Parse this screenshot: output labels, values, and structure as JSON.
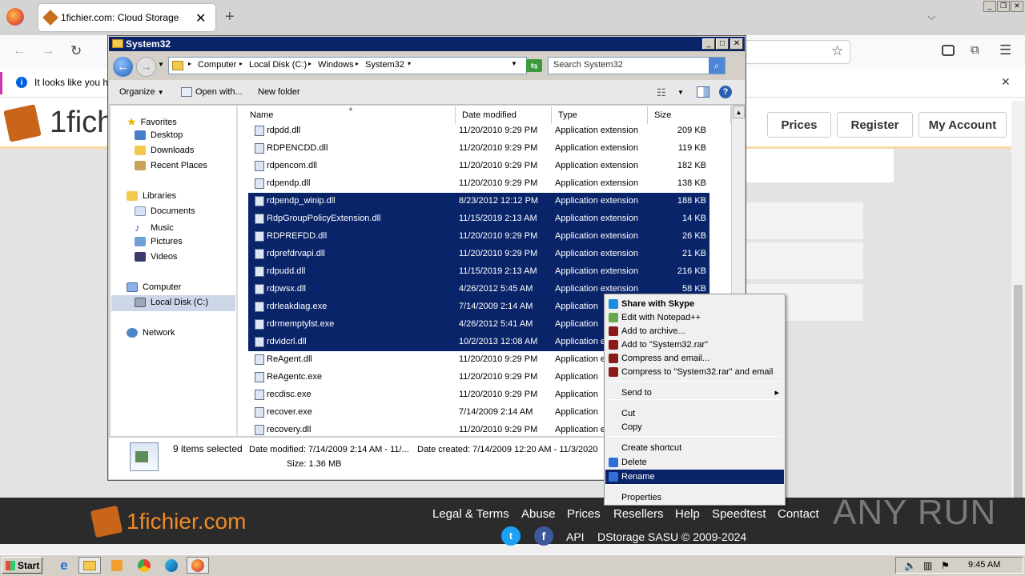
{
  "browser": {
    "tab_title": "1fichier.com: Cloud Storage",
    "notification": "It looks like you ha",
    "colors": {
      "accent": "#c837ab"
    }
  },
  "site": {
    "logo_text": "1fich",
    "nav": {
      "prices": "Prices",
      "register": "Register",
      "account": "My Account"
    },
    "footer": {
      "logo": "1fichier.com",
      "links": [
        "Legal & Terms",
        "Abuse",
        "Prices",
        "Resellers",
        "Help",
        "Speedtest",
        "Contact"
      ],
      "api": "API",
      "copyright": "DStorage SASU © 2009-2024"
    },
    "watermark": "ANY RUN"
  },
  "explorer": {
    "title": "System32",
    "breadcrumb": [
      "Computer",
      "Local Disk (C:)",
      "Windows",
      "System32"
    ],
    "search_placeholder": "Search System32",
    "toolbar": {
      "organize": "Organize",
      "open_with": "Open with...",
      "new_folder": "New folder"
    },
    "nav": {
      "favorites": "Favorites",
      "desktop": "Desktop",
      "downloads": "Downloads",
      "recent": "Recent Places",
      "libraries": "Libraries",
      "documents": "Documents",
      "music": "Music",
      "pictures": "Pictures",
      "videos": "Videos",
      "computer": "Computer",
      "local_disk": "Local Disk (C:)",
      "network": "Network"
    },
    "columns": {
      "name": "Name",
      "date": "Date modified",
      "type": "Type",
      "size": "Size"
    },
    "files": [
      {
        "name": "rdpdd.dll",
        "date": "11/20/2010 9:29 PM",
        "type": "Application extension",
        "size": "209 KB",
        "sel": false
      },
      {
        "name": "RDPENCDD.dll",
        "date": "11/20/2010 9:29 PM",
        "type": "Application extension",
        "size": "119 KB",
        "sel": false
      },
      {
        "name": "rdpencom.dll",
        "date": "11/20/2010 9:29 PM",
        "type": "Application extension",
        "size": "182 KB",
        "sel": false
      },
      {
        "name": "rdpendp.dll",
        "date": "11/20/2010 9:29 PM",
        "type": "Application extension",
        "size": "138 KB",
        "sel": false
      },
      {
        "name": "rdpendp_winip.dll",
        "date": "8/23/2012 12:12 PM",
        "type": "Application extension",
        "size": "188 KB",
        "sel": true
      },
      {
        "name": "RdpGroupPolicyExtension.dll",
        "date": "11/15/2019 2:13 AM",
        "type": "Application extension",
        "size": "14 KB",
        "sel": true
      },
      {
        "name": "RDPREFDD.dll",
        "date": "11/20/2010 9:29 PM",
        "type": "Application extension",
        "size": "26 KB",
        "sel": true
      },
      {
        "name": "rdprefdrvapi.dll",
        "date": "11/20/2010 9:29 PM",
        "type": "Application extension",
        "size": "21 KB",
        "sel": true
      },
      {
        "name": "rdpudd.dll",
        "date": "11/15/2019 2:13 AM",
        "type": "Application extension",
        "size": "216 KB",
        "sel": true
      },
      {
        "name": "rdpwsx.dll",
        "date": "4/26/2012 5:45 AM",
        "type": "Application extension",
        "size": "58 KB",
        "sel": true
      },
      {
        "name": "rdrleakdiag.exe",
        "date": "7/14/2009 2:14 AM",
        "type": "Application",
        "size": "",
        "sel": true
      },
      {
        "name": "rdrmemptylst.exe",
        "date": "4/26/2012 5:41 AM",
        "type": "Application",
        "size": "",
        "sel": true
      },
      {
        "name": "rdvidcrl.dll",
        "date": "10/2/2013 12:08 AM",
        "type": "Application e",
        "size": "",
        "sel": true
      },
      {
        "name": "ReAgent.dll",
        "date": "11/20/2010 9:29 PM",
        "type": "Application e",
        "size": "",
        "sel": false
      },
      {
        "name": "ReAgentc.exe",
        "date": "11/20/2010 9:29 PM",
        "type": "Application",
        "size": "",
        "sel": false
      },
      {
        "name": "recdisc.exe",
        "date": "11/20/2010 9:29 PM",
        "type": "Application",
        "size": "",
        "sel": false
      },
      {
        "name": "recover.exe",
        "date": "7/14/2009 2:14 AM",
        "type": "Application",
        "size": "",
        "sel": false
      },
      {
        "name": "recovery.dll",
        "date": "11/20/2010 9:29 PM",
        "type": "Application e",
        "size": "",
        "sel": false
      }
    ],
    "status": {
      "count": "9 items selected",
      "modified": "Date modified: 7/14/2009 2:14 AM - 11/...",
      "created": "Date created: 7/14/2009 12:20 AM - 11/3/2020",
      "size": "Size: 1.36 MB"
    }
  },
  "context_menu": [
    {
      "label": "Share with Skype",
      "bold": true,
      "icon": "skype-icon",
      "color": "#1a8ee0"
    },
    {
      "label": "Edit with Notepad++",
      "icon": "notepad-icon",
      "color": "#6aa84f"
    },
    {
      "label": "Add to archive...",
      "icon": "winrar-icon",
      "color": "#8b1a1a"
    },
    {
      "label": "Add to \"System32.rar\"",
      "icon": "winrar-icon",
      "color": "#8b1a1a"
    },
    {
      "label": "Compress and email...",
      "icon": "winrar-icon",
      "color": "#8b1a1a"
    },
    {
      "label": "Compress to \"System32.rar\" and email",
      "icon": "winrar-icon",
      "color": "#8b1a1a"
    },
    {
      "label": "Send to",
      "arrow": true
    },
    {
      "label": "Cut"
    },
    {
      "label": "Copy"
    },
    {
      "label": "Create shortcut"
    },
    {
      "label": "Delete",
      "icon": "shield-icon",
      "color": "#2f6fd6"
    },
    {
      "label": "Rename",
      "icon": "shield-icon",
      "color": "#2f6fd6",
      "highlight": true
    },
    {
      "label": "Properties"
    }
  ],
  "taskbar": {
    "start": "Start",
    "clock": "9:45 AM"
  }
}
